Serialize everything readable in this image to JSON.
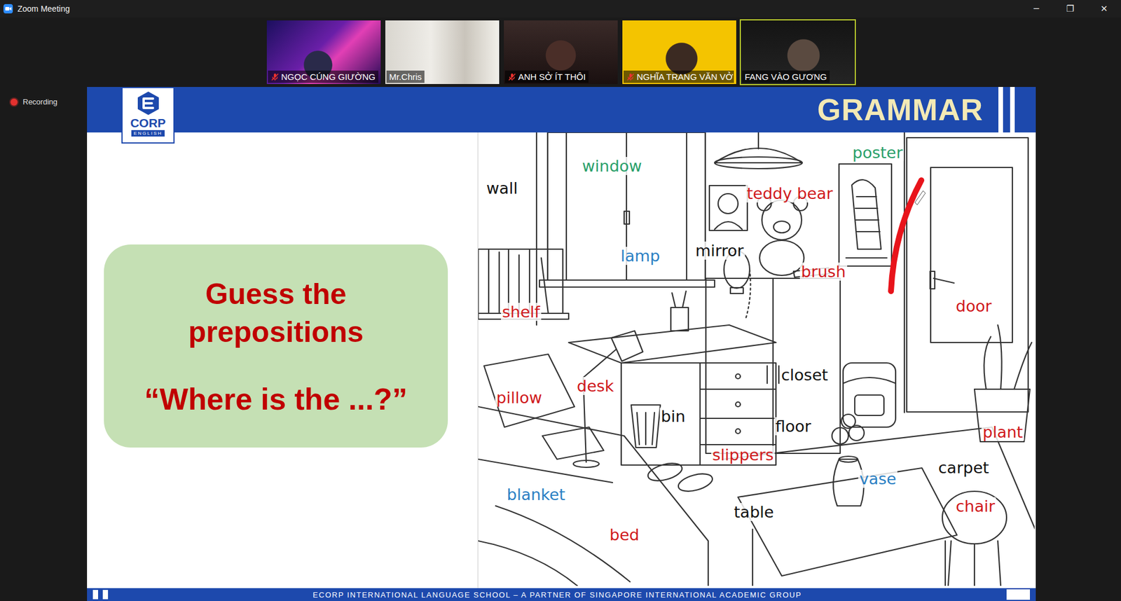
{
  "window": {
    "title": "Zoom Meeting",
    "controls": [
      "─",
      "❐",
      "✕"
    ]
  },
  "participants": [
    {
      "name": "NGỌC CÚNG GIƯỜNG",
      "muted": true,
      "speaking": false
    },
    {
      "name": "Mr.Chris",
      "muted": false,
      "speaking": false
    },
    {
      "name": "ANH SỞ ÍT THÔI",
      "muted": true,
      "speaking": false
    },
    {
      "name": "NGHĨA TRANG VĂN VỞ",
      "muted": true,
      "speaking": false
    },
    {
      "name": "FANG VÀO GƯƠNG",
      "muted": false,
      "speaking": true
    }
  ],
  "recording": {
    "label": "Recording"
  },
  "slide": {
    "logo": {
      "brand": "CORP",
      "sub": "ENGLISH"
    },
    "heading": "GRAMMAR",
    "card": {
      "title": [
        "Guess the",
        "prepositions"
      ],
      "question": "“Where is the ...?”"
    },
    "labels": [
      {
        "text": "window",
        "color": "#2aa06a"
      },
      {
        "text": "wall",
        "color": "#111111"
      },
      {
        "text": "poster",
        "color": "#2aa06a"
      },
      {
        "text": "teddy bear",
        "color": "#d0181b"
      },
      {
        "text": "lamp",
        "color": "#2a7fc4"
      },
      {
        "text": "mirror",
        "color": "#111111"
      },
      {
        "text": "brush",
        "color": "#d0181b"
      },
      {
        "text": "shelf",
        "color": "#d0181b"
      },
      {
        "text": "door",
        "color": "#d0181b"
      },
      {
        "text": "closet",
        "color": "#111111"
      },
      {
        "text": "desk",
        "color": "#d0181b"
      },
      {
        "text": "pillow",
        "color": "#d0181b"
      },
      {
        "text": "bin",
        "color": "#111111"
      },
      {
        "text": "floor",
        "color": "#111111"
      },
      {
        "text": "plant",
        "color": "#d0181b"
      },
      {
        "text": "slippers",
        "color": "#d0181b"
      },
      {
        "text": "carpet",
        "color": "#111111"
      },
      {
        "text": "vase",
        "color": "#2a7fc4"
      },
      {
        "text": "blanket",
        "color": "#2a7fc4"
      },
      {
        "text": "table",
        "color": "#111111"
      },
      {
        "text": "chair",
        "color": "#d0181b"
      },
      {
        "text": "bed",
        "color": "#d0181b"
      }
    ],
    "footer": "ECORP INTERNATIONAL LANGUAGE SCHOOL – A PARTNER OF SINGAPORE INTERNATIONAL ACADEMIC GROUP"
  }
}
